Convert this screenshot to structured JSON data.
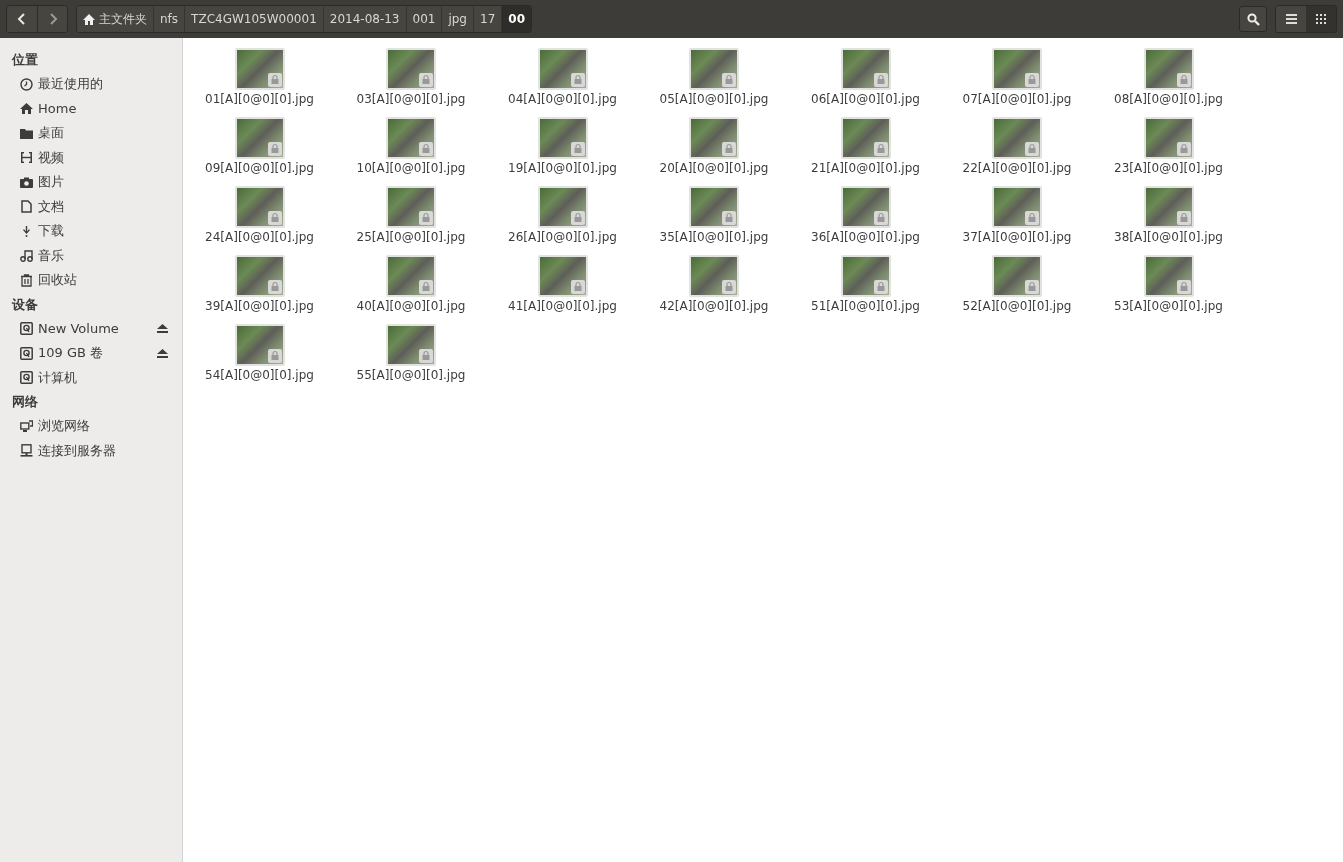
{
  "toolbar": {
    "breadcrumbs": [
      {
        "label": "主文件夹",
        "kind": "home",
        "selected": false
      },
      {
        "label": "nfs",
        "kind": "folder",
        "selected": false
      },
      {
        "label": "TZC4GW105W00001",
        "kind": "folder",
        "selected": false
      },
      {
        "label": "2014-08-13",
        "kind": "folder",
        "selected": false
      },
      {
        "label": "001",
        "kind": "folder",
        "selected": false
      },
      {
        "label": "jpg",
        "kind": "folder",
        "selected": false
      },
      {
        "label": "17",
        "kind": "folder",
        "selected": false
      },
      {
        "label": "00",
        "kind": "folder",
        "selected": true
      }
    ],
    "views": [
      {
        "kind": "list",
        "selected": false
      },
      {
        "kind": "grid",
        "selected": true
      }
    ]
  },
  "sidebar": {
    "sections": [
      {
        "title": "位置",
        "items": [
          {
            "label": "最近使用的",
            "kind": "recent",
            "ejectable": false
          },
          {
            "label": "Home",
            "kind": "home",
            "ejectable": false
          },
          {
            "label": "桌面",
            "kind": "desktop",
            "ejectable": false
          },
          {
            "label": "视频",
            "kind": "video",
            "ejectable": false
          },
          {
            "label": "图片",
            "kind": "camera",
            "ejectable": false
          },
          {
            "label": "文档",
            "kind": "document",
            "ejectable": false
          },
          {
            "label": "下载",
            "kind": "download",
            "ejectable": false
          },
          {
            "label": "音乐",
            "kind": "music",
            "ejectable": false
          },
          {
            "label": "回收站",
            "kind": "trash",
            "ejectable": false
          }
        ]
      },
      {
        "title": "设备",
        "items": [
          {
            "label": "New Volume",
            "kind": "drive",
            "ejectable": true
          },
          {
            "label": "109 GB 卷",
            "kind": "drive",
            "ejectable": true
          },
          {
            "label": "计算机",
            "kind": "drive",
            "ejectable": false
          }
        ]
      },
      {
        "title": "网络",
        "items": [
          {
            "label": "浏览网络",
            "kind": "network",
            "ejectable": false
          },
          {
            "label": "连接到服务器",
            "kind": "server",
            "ejectable": false
          }
        ]
      }
    ]
  },
  "files": [
    {
      "name": "01[A][0@0][0].jpg",
      "locked": true
    },
    {
      "name": "03[A][0@0][0].jpg",
      "locked": true
    },
    {
      "name": "04[A][0@0][0].jpg",
      "locked": true
    },
    {
      "name": "05[A][0@0][0].jpg",
      "locked": true
    },
    {
      "name": "06[A][0@0][0].jpg",
      "locked": true
    },
    {
      "name": "07[A][0@0][0].jpg",
      "locked": true
    },
    {
      "name": "08[A][0@0][0].jpg",
      "locked": true
    },
    {
      "name": "09[A][0@0][0].jpg",
      "locked": true
    },
    {
      "name": "10[A][0@0][0].jpg",
      "locked": true
    },
    {
      "name": "19[A][0@0][0].jpg",
      "locked": true
    },
    {
      "name": "20[A][0@0][0].jpg",
      "locked": true
    },
    {
      "name": "21[A][0@0][0].jpg",
      "locked": true
    },
    {
      "name": "22[A][0@0][0].jpg",
      "locked": true
    },
    {
      "name": "23[A][0@0][0].jpg",
      "locked": true
    },
    {
      "name": "24[A][0@0][0].jpg",
      "locked": true
    },
    {
      "name": "25[A][0@0][0].jpg",
      "locked": true
    },
    {
      "name": "26[A][0@0][0].jpg",
      "locked": true
    },
    {
      "name": "35[A][0@0][0].jpg",
      "locked": true
    },
    {
      "name": "36[A][0@0][0].jpg",
      "locked": true
    },
    {
      "name": "37[A][0@0][0].jpg",
      "locked": true
    },
    {
      "name": "38[A][0@0][0].jpg",
      "locked": true
    },
    {
      "name": "39[A][0@0][0].jpg",
      "locked": true
    },
    {
      "name": "40[A][0@0][0].jpg",
      "locked": true
    },
    {
      "name": "41[A][0@0][0].jpg",
      "locked": true
    },
    {
      "name": "42[A][0@0][0].jpg",
      "locked": true
    },
    {
      "name": "51[A][0@0][0].jpg",
      "locked": true
    },
    {
      "name": "52[A][0@0][0].jpg",
      "locked": true
    },
    {
      "name": "53[A][0@0][0].jpg",
      "locked": true
    },
    {
      "name": "54[A][0@0][0].jpg",
      "locked": true
    },
    {
      "name": "55[A][0@0][0].jpg",
      "locked": true
    }
  ]
}
